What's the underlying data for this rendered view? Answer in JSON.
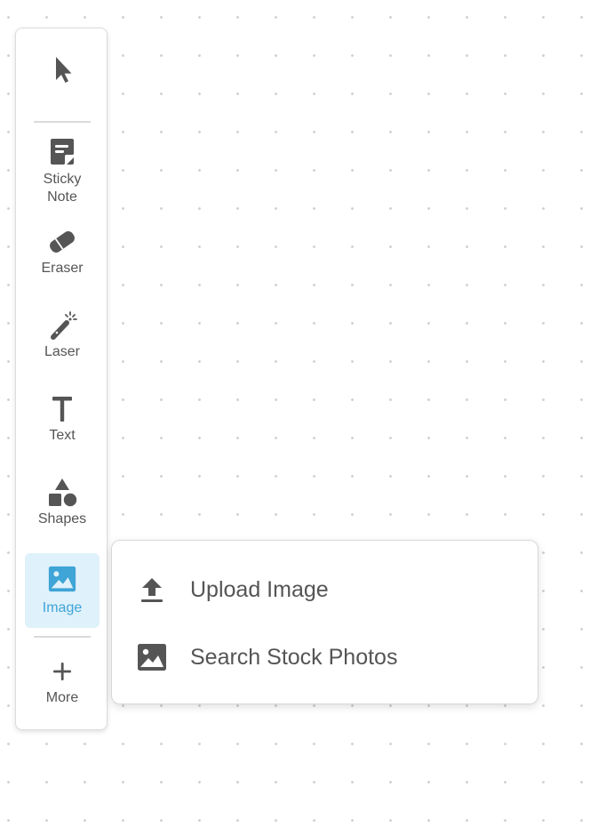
{
  "toolbar": {
    "tools": [
      {
        "id": "select",
        "label": "",
        "icon": "cursor-arrow-icon"
      },
      {
        "id": "sticky-note",
        "label": "Sticky\nNote",
        "label_line1": "Sticky",
        "label_line2": "Note",
        "icon": "sticky-note-icon"
      },
      {
        "id": "eraser",
        "label": "Eraser",
        "icon": "eraser-icon"
      },
      {
        "id": "laser",
        "label": "Laser",
        "icon": "laser-pointer-icon"
      },
      {
        "id": "text",
        "label": "Text",
        "icon": "text-icon"
      },
      {
        "id": "shapes",
        "label": "Shapes",
        "icon": "shapes-icon"
      },
      {
        "id": "image",
        "label": "Image",
        "icon": "image-icon",
        "active": true
      },
      {
        "id": "more",
        "label": "More",
        "icon": "plus-icon"
      }
    ]
  },
  "image_menu": {
    "items": [
      {
        "label": "Upload Image",
        "icon": "upload-icon"
      },
      {
        "label": "Search Stock Photos",
        "icon": "image-icon"
      }
    ]
  },
  "colors": {
    "icon_gray": "#555555",
    "active_bg": "#dff1fb",
    "active_fg": "#3fa4d6",
    "canvas_dot": "#d2d2d2"
  }
}
